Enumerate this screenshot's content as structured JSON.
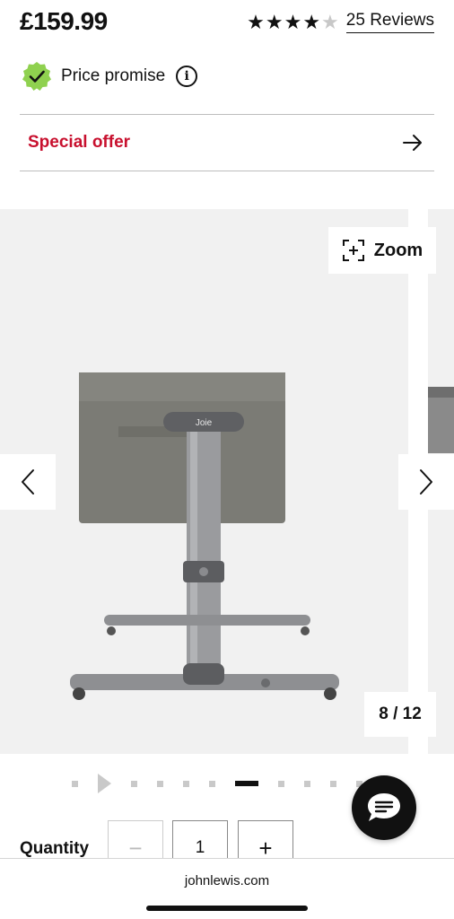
{
  "product": {
    "price": "£159.99",
    "rating": 4,
    "rating_max": 5,
    "reviews_label": "25 Reviews"
  },
  "price_promise": {
    "label": "Price promise",
    "info_icon": "i"
  },
  "special_offer": {
    "label": "Special offer",
    "icon": "arrow-right-icon"
  },
  "gallery": {
    "zoom_label": "Zoom",
    "counter": "8 / 12",
    "brand_on_product": "Joie",
    "current_index": 8,
    "total": 12,
    "indicator_count": 11,
    "indicator_active": 6
  },
  "quantity": {
    "label": "Quantity",
    "minus": "−",
    "value": "1",
    "plus": "+"
  },
  "browser": {
    "url": "johnlewis.com"
  },
  "colors": {
    "accent_red": "#c8102e",
    "badge_green": "#8fd14f",
    "gallery_bg": "#f1f1f1"
  }
}
